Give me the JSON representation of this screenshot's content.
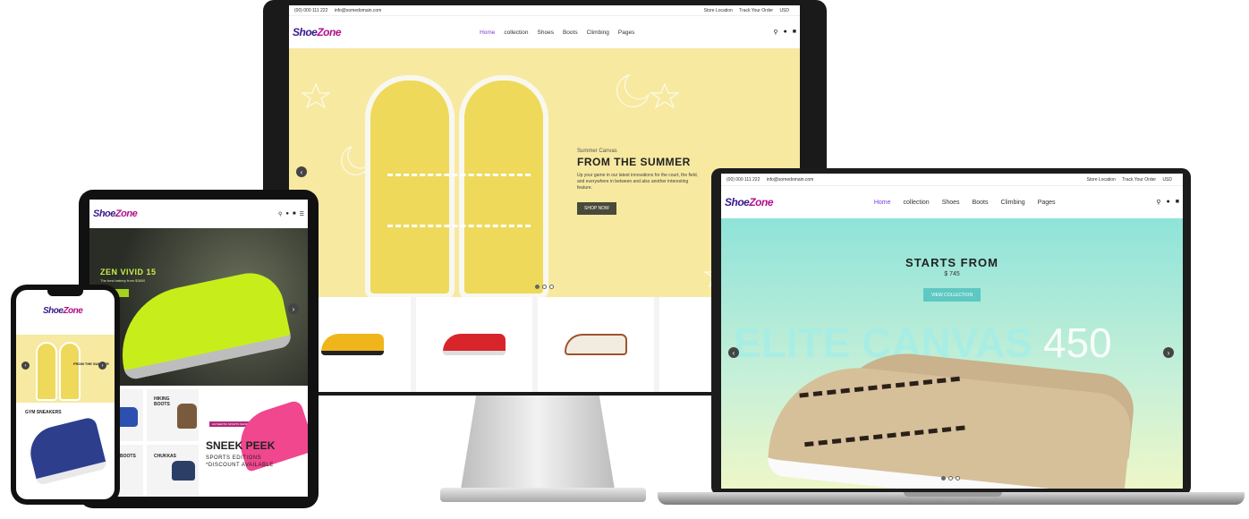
{
  "brand": {
    "logo_a": "Shoe",
    "logo_b": "Zone",
    "accent": "#7b3fd6",
    "logo_color": "#3a1a8c",
    "logo_color2": "#b0108a"
  },
  "desktop": {
    "topbar": {
      "phone": "(00) 000 111 222",
      "email": "info@somedomain.com",
      "store": "Store Location",
      "track": "Track Your Order",
      "currency": "USD"
    },
    "menu": [
      "Home",
      "collection",
      "Shoes",
      "Boots",
      "Climbing",
      "Pages"
    ],
    "hero": {
      "kicker": "Summer Canvas",
      "title": "FROM THE SUMMER",
      "text": "Up your game in our latest innovations for the court, the field, and everywhere in between and also another interesting feature.",
      "cta": "SHOP NOW"
    },
    "products": [
      "yellow-cleat",
      "red-cleat",
      "white-sneaker",
      "partial-shoe"
    ]
  },
  "laptop": {
    "topbar": {
      "phone": "(00) 000 111 222",
      "email": "info@somedomain.com",
      "store": "Store Location",
      "track": "Track Your Order",
      "currency": "USD"
    },
    "menu": [
      "Home",
      "collection",
      "Shoes",
      "Boots",
      "Climbing",
      "Pages"
    ],
    "hero": {
      "title": "STARTS FROM",
      "price": "$ 745",
      "cta": "VIEW COLLECTION",
      "bg_text": "ELITE CANVAS",
      "bg_num": "450"
    }
  },
  "tablet": {
    "hero": {
      "title": "ZEN VIVID 15",
      "sub": "The best battery from $3600"
    },
    "tiles": {
      "hiking": "HIKING BOOTS",
      "chukkas": "CHUKKAS",
      "boots": "BOOTS",
      "sneek": "SNEEK PEEK",
      "sports": "SPORTS EDITIONS",
      "discount": "*DISCOUNT AVAILABLE",
      "badge": "AUTHENTIC SPORTS SHOES"
    }
  },
  "phone": {
    "hero": {
      "title": "FROM THE SUMMER"
    },
    "section": "GYM SNEAKERS"
  },
  "icons": {
    "search": "search-icon",
    "user": "user-icon",
    "cart": "cart-icon",
    "menu": "hamburger-icon",
    "prev": "chevron-left-icon",
    "next": "chevron-right-icon"
  }
}
